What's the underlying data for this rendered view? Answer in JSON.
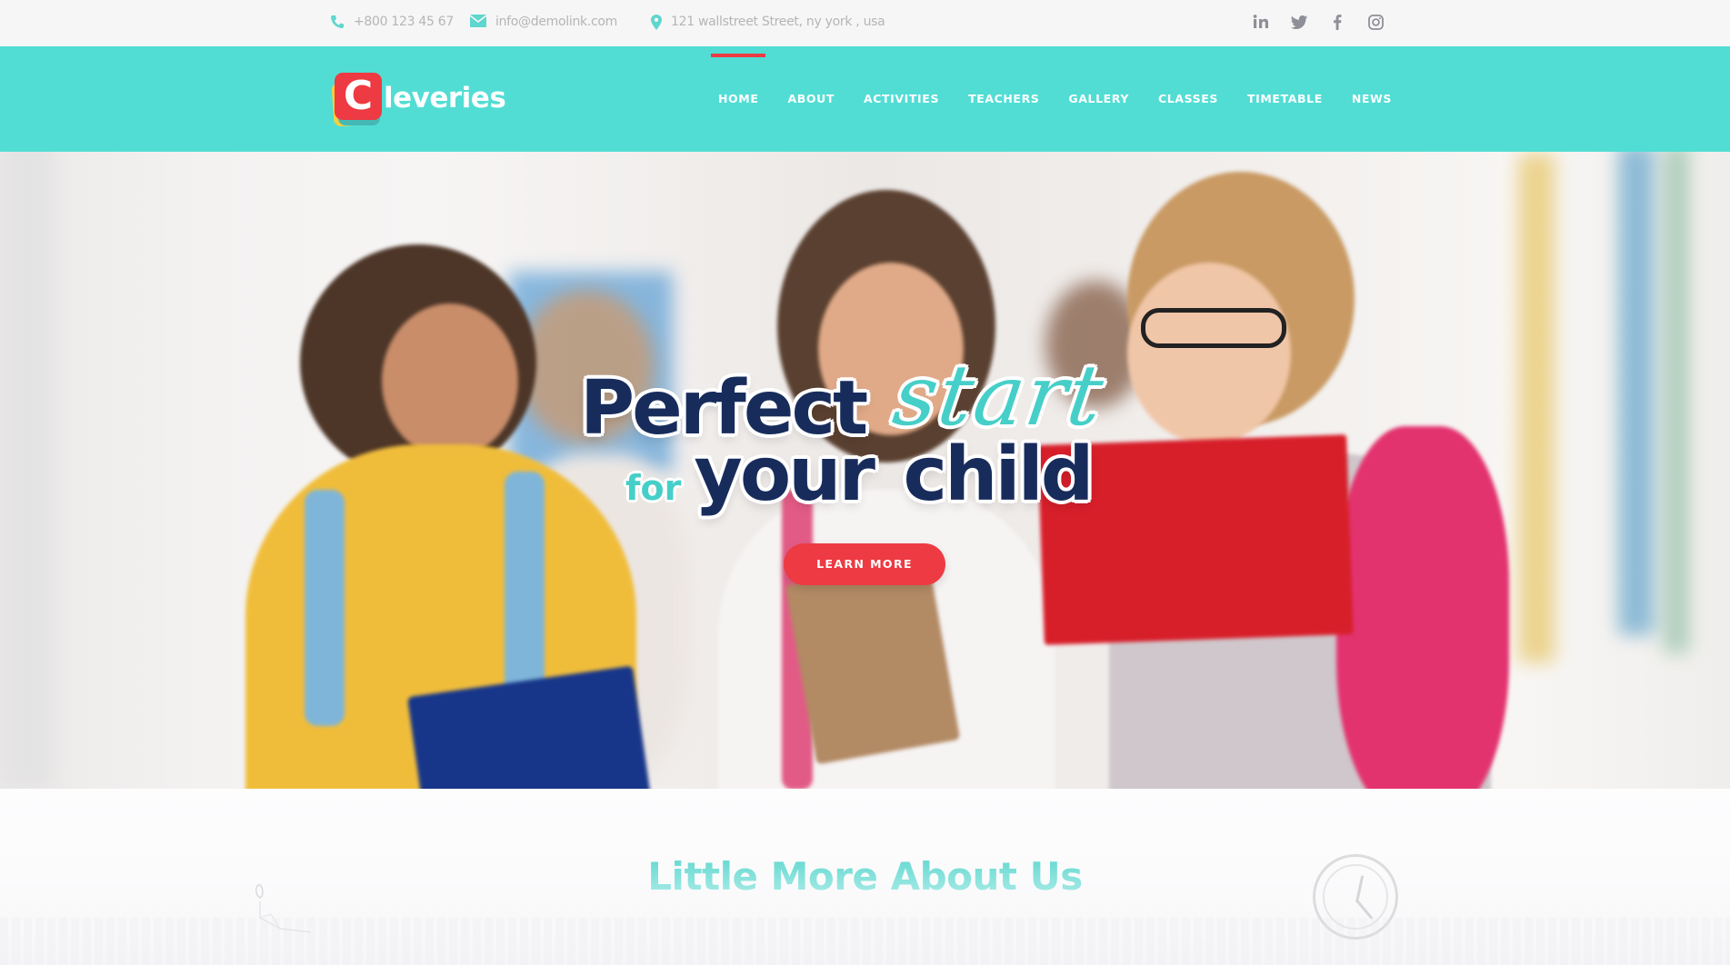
{
  "topbar": {
    "phone": "+800 123 45 67",
    "email": "info@demolink.com",
    "address": "121 wallstreet Street, ny york , usa",
    "icons": {
      "phone": "phone-icon",
      "email": "envelope-icon",
      "address": "map-marker-icon"
    },
    "socials": [
      {
        "name": "linkedin",
        "glyph": "in"
      },
      {
        "name": "twitter",
        "glyph": "🐦"
      },
      {
        "name": "facebook",
        "glyph": "f"
      },
      {
        "name": "instagram",
        "glyph": "◎"
      }
    ]
  },
  "header": {
    "logo": {
      "letter": "C",
      "word": "leveries"
    },
    "nav": [
      {
        "label": "HOME",
        "active": true
      },
      {
        "label": "ABOUT",
        "active": false
      },
      {
        "label": "ACTIVITIES",
        "active": false
      },
      {
        "label": "TEACHERS",
        "active": false
      },
      {
        "label": "GALLERY",
        "active": false
      },
      {
        "label": "CLASSES",
        "active": false
      },
      {
        "label": "TIMETABLE",
        "active": false
      },
      {
        "label": "NEWS",
        "active": false
      }
    ]
  },
  "hero": {
    "line1_main": "Perfect",
    "line1_script": "start",
    "line2_small": "for",
    "line2_main": "your child",
    "cta_label": "LEARN MORE"
  },
  "about": {
    "title": "Little More About Us"
  },
  "colors": {
    "teal": "#4edcd3",
    "red": "#ee3a42",
    "navy": "#182c5c",
    "topbar_bg": "#f6f6f6",
    "muted_text": "#b5b5b5"
  }
}
